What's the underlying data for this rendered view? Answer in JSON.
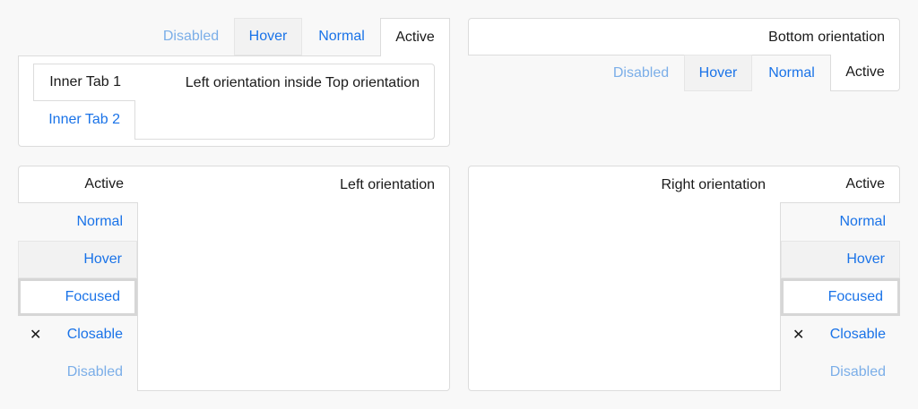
{
  "top_panel": {
    "tabs": [
      "Disabled",
      "Hover",
      "Normal",
      "Active"
    ],
    "inner_tabs": [
      "Inner Tab 1",
      "Inner Tab 2"
    ],
    "inner_content": "Left orientation inside Top orientation"
  },
  "bottom_panel": {
    "content": "Bottom orientation",
    "tabs": [
      "Disabled",
      "Hover",
      "Normal",
      "Active"
    ]
  },
  "left_panel": {
    "content": "Left orientation",
    "tabs": [
      "Active",
      "Normal",
      "Hover",
      "Focused",
      "Closable",
      "Disabled"
    ]
  },
  "right_panel": {
    "content": "Right orientation",
    "tabs": [
      "Active",
      "Normal",
      "Hover",
      "Focused",
      "Closable",
      "Disabled"
    ]
  },
  "icons": {
    "close": "close-icon"
  }
}
